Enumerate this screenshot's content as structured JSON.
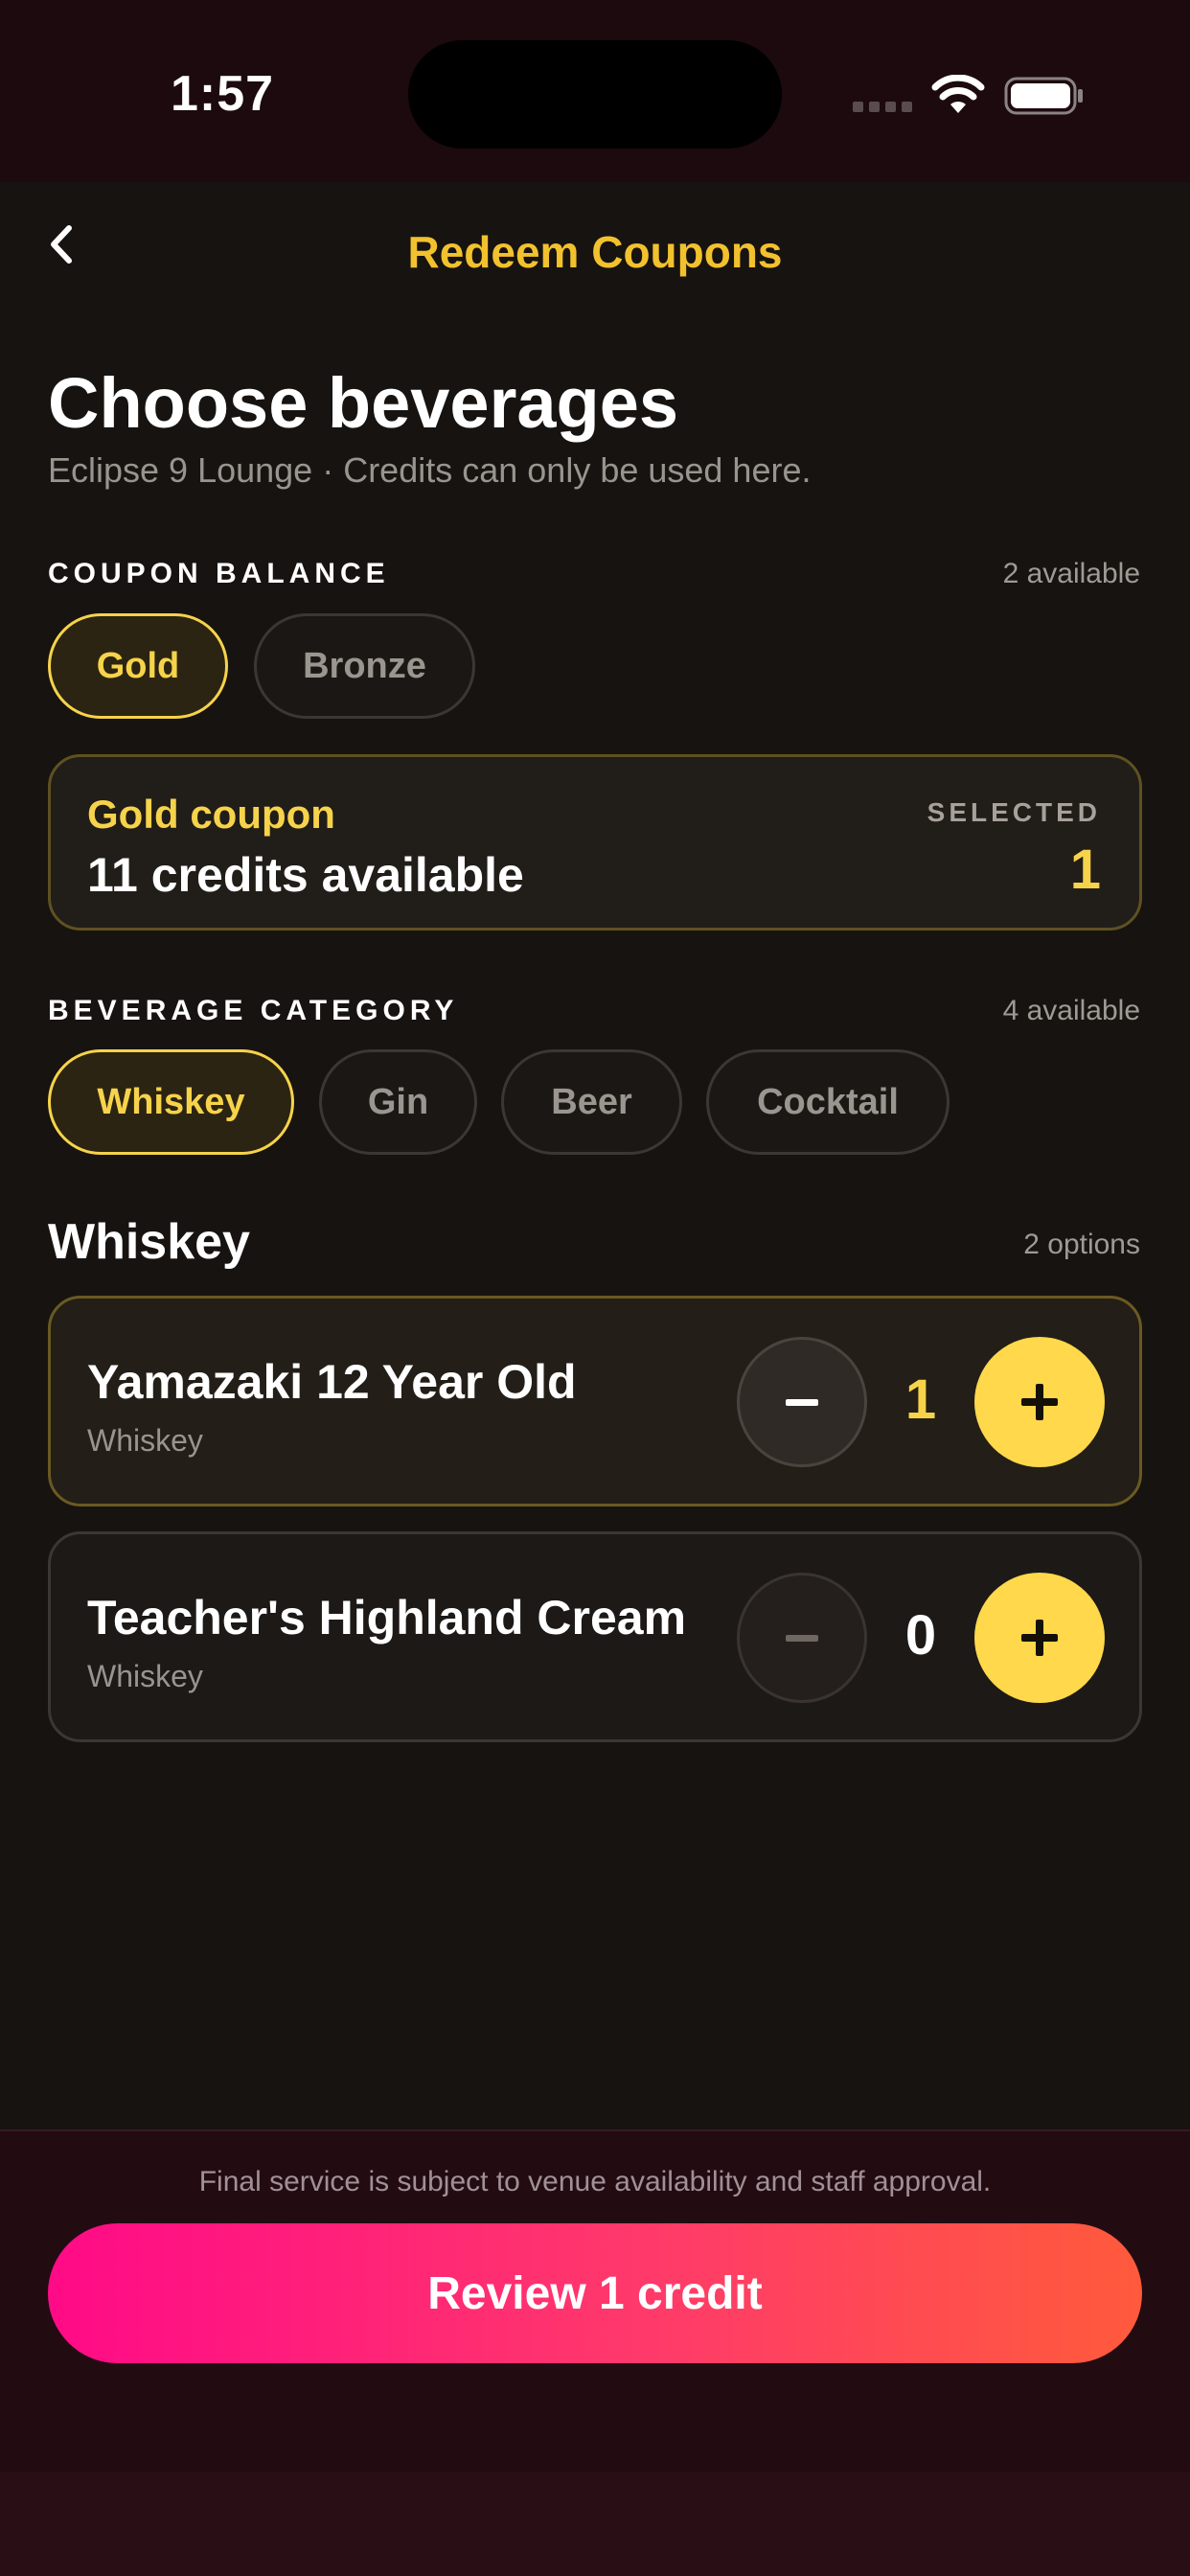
{
  "status_bar": {
    "time": "1:57"
  },
  "nav": {
    "title": "Redeem Coupons",
    "back_icon": "chevron-left-icon"
  },
  "header": {
    "title": "Choose beverages",
    "subtitle": "Eclipse 9 Lounge · Credits can only be used here."
  },
  "coupon_balance": {
    "label": "COUPON BALANCE",
    "meta": "2 available",
    "options": [
      "Gold",
      "Bronze"
    ],
    "selected": "Gold"
  },
  "coupon_card": {
    "name": "Gold coupon",
    "credits": "11 credits available",
    "selected_label": "SELECTED",
    "selected_value": "1"
  },
  "beverage_category": {
    "label": "BEVERAGE CATEGORY",
    "meta": "4 available",
    "options": [
      "Whiskey",
      "Gin",
      "Beer",
      "Cocktail"
    ],
    "selected": "Whiskey"
  },
  "list": {
    "title": "Whiskey",
    "meta": "2 options",
    "items": [
      {
        "name": "Yamazaki 12 Year Old",
        "category": "Whiskey",
        "qty": "1"
      },
      {
        "name": "Teacher's Highland Cream",
        "category": "Whiskey",
        "qty": "0"
      }
    ]
  },
  "footer": {
    "note": "Final service is subject to venue availability and staff approval.",
    "cta": "Review 1 credit"
  },
  "colors": {
    "accent_gold": "#f6d34a",
    "title_gold": "#f2c12e",
    "cta_start": "#ff0a87",
    "cta_end": "#ff5a3c",
    "background": "#171310"
  }
}
